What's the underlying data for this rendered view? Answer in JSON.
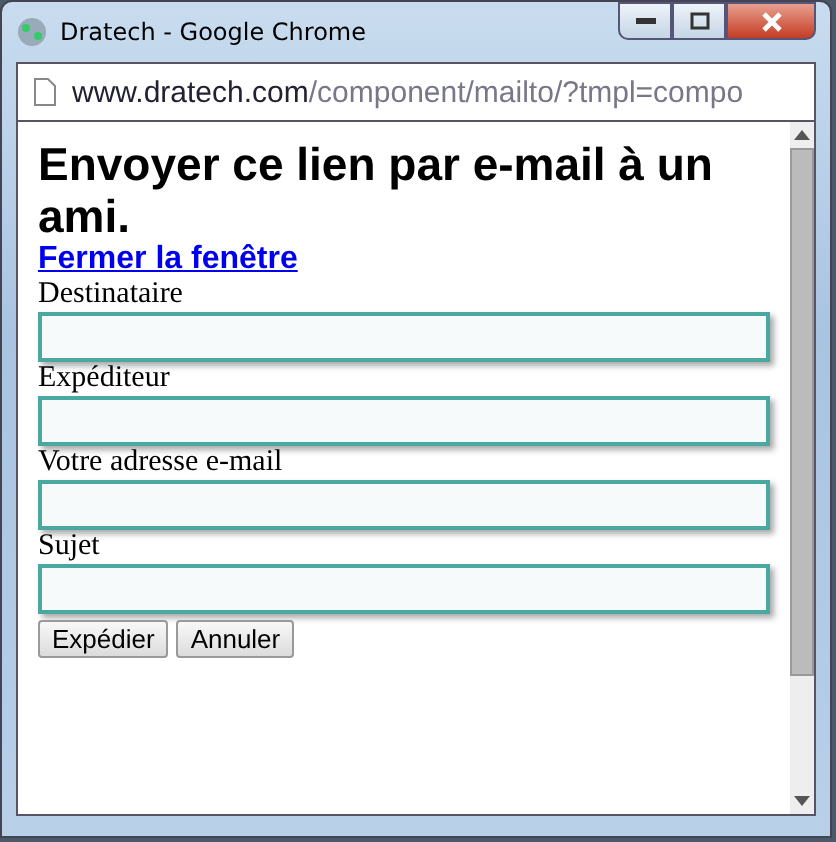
{
  "window": {
    "title": "Dratech - Google Chrome"
  },
  "address_bar": {
    "host": "www.dratech.com",
    "path": "/component/mailto/?tmpl=compo"
  },
  "page": {
    "heading": "Envoyer ce lien par e-mail à un ami.",
    "close_link": "Fermer la fenêtre",
    "fields": [
      {
        "label": "Destinataire"
      },
      {
        "label": "Expéditeur"
      },
      {
        "label": "Votre adresse e-mail"
      },
      {
        "label": "Sujet"
      }
    ],
    "buttons": [
      "Expédier",
      "Annuler"
    ]
  }
}
